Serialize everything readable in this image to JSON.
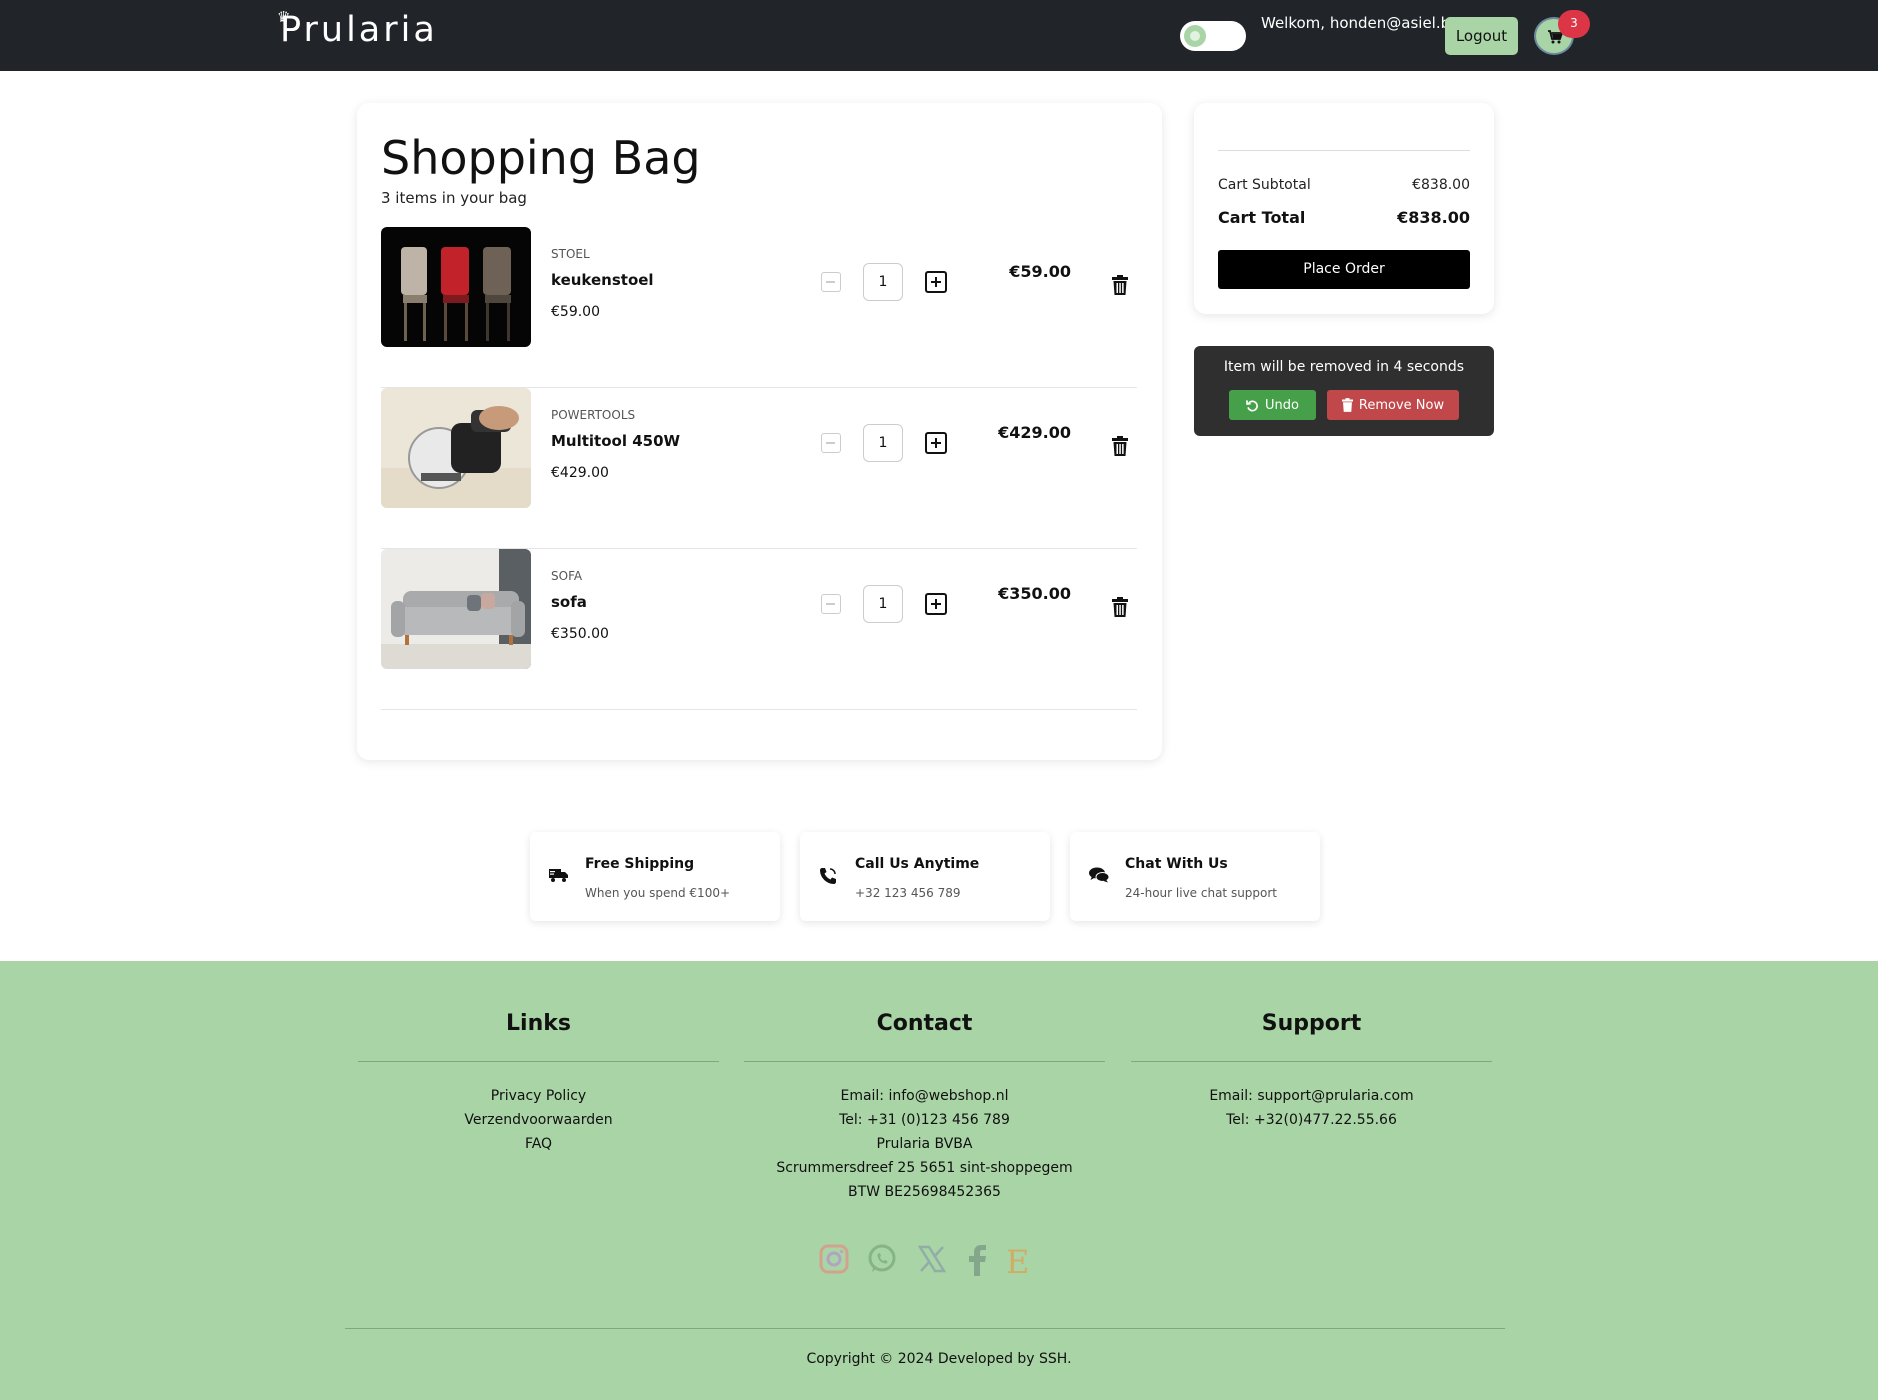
{
  "header": {
    "brand": "Prularia",
    "welcome": "Welkom, honden@asiel.be!",
    "logout_label": "Logout",
    "cart_count": "3"
  },
  "bag": {
    "title": "Shopping Bag",
    "subtitle": "3 items in your bag",
    "items": [
      {
        "category": "STOEL",
        "name": "keukenstoel",
        "unit_price": "€59.00",
        "quantity": "1",
        "total": "€59.00"
      },
      {
        "category": "POWERTOOLS",
        "name": "Multitool 450W",
        "unit_price": "€429.00",
        "quantity": "1",
        "total": "€429.00"
      },
      {
        "category": "SOFA",
        "name": "sofa",
        "unit_price": "€350.00",
        "quantity": "1",
        "total": "€350.00"
      }
    ]
  },
  "summary": {
    "subtotal_label": "Cart Subtotal",
    "subtotal_value": "€838.00",
    "total_label": "Cart Total",
    "total_value": "€838.00",
    "place_order_label": "Place Order"
  },
  "toast": {
    "message": "Item will be removed in 4 seconds",
    "undo_label": "Undo",
    "remove_label": "Remove Now"
  },
  "features": [
    {
      "icon": "truck-icon",
      "title": "Free Shipping",
      "text": "When you spend €100+"
    },
    {
      "icon": "phone-icon",
      "title": "Call Us Anytime",
      "text": "+32 123 456 789"
    },
    {
      "icon": "chat-icon",
      "title": "Chat With Us",
      "text": "24-hour live chat support"
    }
  ],
  "footer": {
    "links": {
      "title": "Links",
      "items": [
        "Privacy Policy",
        "Verzendvoorwaarden",
        "FAQ"
      ]
    },
    "contact": {
      "title": "Contact",
      "lines": [
        "Email: info@webshop.nl",
        "Tel: +31 (0)123 456 789",
        "Prularia BVBA",
        "Scrummersdreef 25 5651 sint-shoppegem",
        "BTW BE25698452365"
      ]
    },
    "support": {
      "title": "Support",
      "lines": [
        "Email: support@prularia.com",
        "Tel: +32(0)477.22.55.66"
      ]
    },
    "socials": [
      "instagram-icon",
      "whatsapp-icon",
      "x-icon",
      "facebook-icon",
      "etsy-icon"
    ],
    "copyright": "Copyright © 2024 Developed by SSH."
  },
  "colors": {
    "header_bg": "#212529",
    "accent_green": "#a9d4a6",
    "badge_red": "#dc3545",
    "undo_green": "#46a049",
    "remove_red": "#c0484a",
    "toast_bg": "#2f2f2f"
  }
}
